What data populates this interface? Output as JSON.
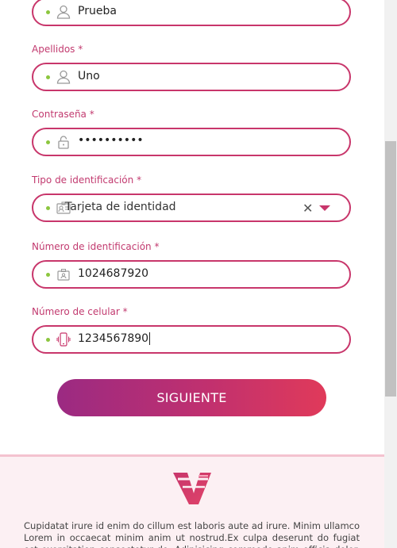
{
  "fields": [
    {
      "label": "",
      "value": "Prueba",
      "icon": "user-icon"
    },
    {
      "label": "Apellidos *",
      "value": "Uno",
      "icon": "user-icon"
    },
    {
      "label": "Contraseña *",
      "value": "••••••••••",
      "icon": "lock-icon"
    },
    {
      "label": "Tipo de identificación *",
      "value": "Tarjeta de identidad",
      "icon": "id-card-icon",
      "clear": "✕"
    },
    {
      "label": "Número de identificación *",
      "value": "1024687920",
      "icon": "id-badge-icon"
    },
    {
      "label": "Número de celular *",
      "value": "1234567890",
      "icon": "mobile-phone-icon"
    }
  ],
  "submit_label": "SIGUIENTE",
  "footer": {
    "text": "Cupidatat irure id enim do cillum est laboris aute ad irure. Minim ullamco Lorem in occaecat minim anim ut nostrud.Ex culpa deserunt do fugiat est exercitation consectetur do. Adipisicing commodo anim officia dolor. Cupidatat irure id enim"
  },
  "colors": {
    "accent": "#c8366b",
    "dot": "#8cc63f",
    "label": "#c23a6f"
  }
}
